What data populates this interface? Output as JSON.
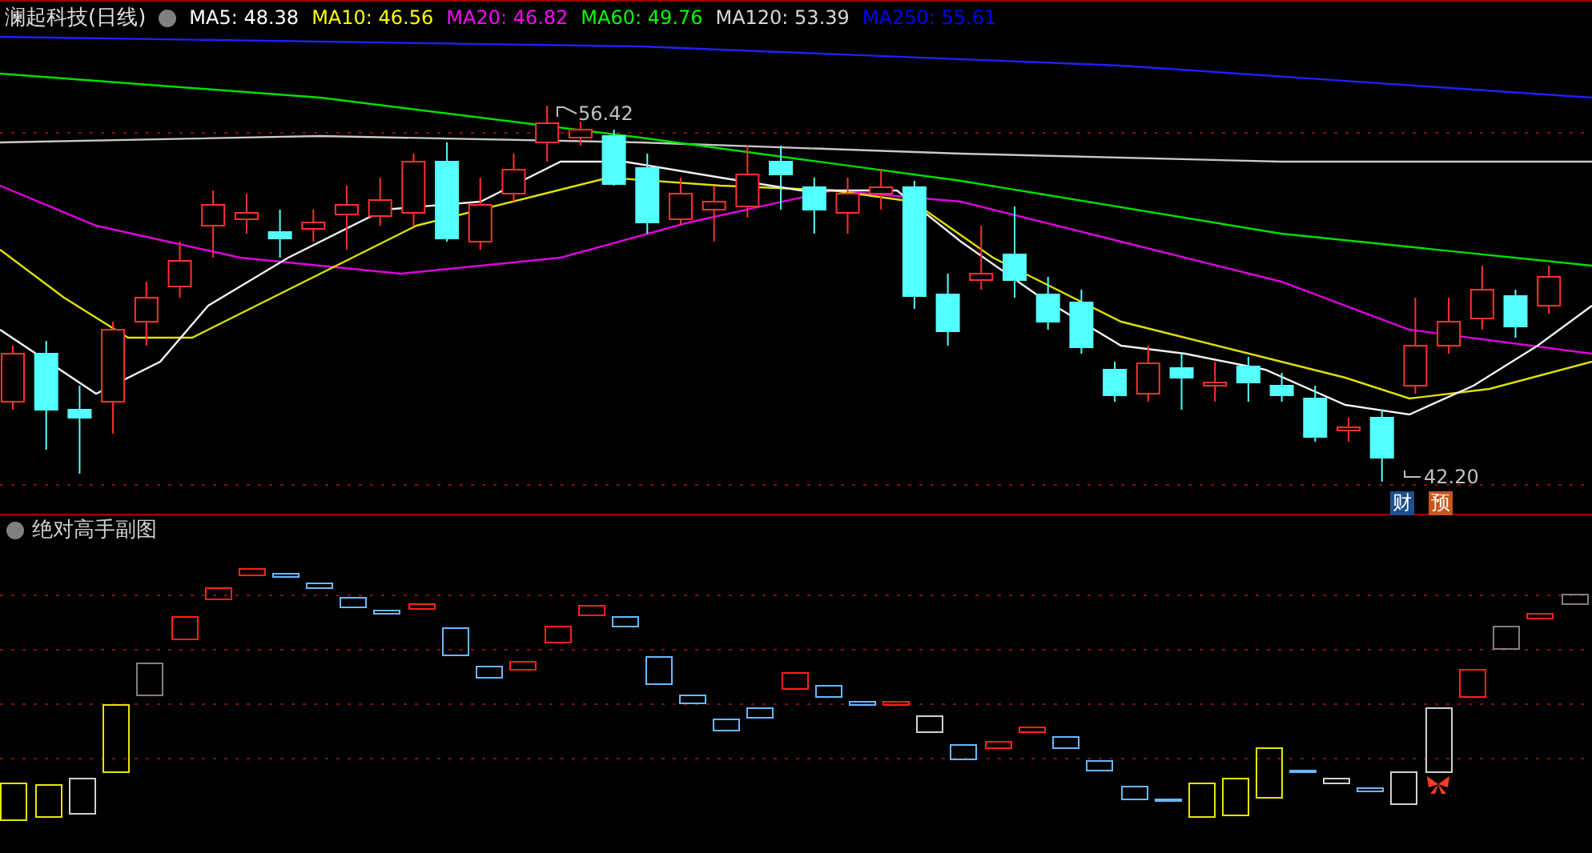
{
  "chart": {
    "title": "澜起科技(日线)",
    "indicators": [
      {
        "label": "MA5: 48.38",
        "color": "#ffffff"
      },
      {
        "label": "MA10: 46.56",
        "color": "#ffff00"
      },
      {
        "label": "MA20: 46.82",
        "color": "#ff00ff"
      },
      {
        "label": "MA60: 49.76",
        "color": "#00ff00"
      },
      {
        "label": "MA120: 53.39",
        "color": "#d8d8d8"
      },
      {
        "label": "MA250: 55.61",
        "color": "#0000ff"
      }
    ],
    "price_marks": [
      {
        "text": "56.42"
      },
      {
        "text": "42.20"
      }
    ],
    "event_badges": [
      {
        "text": "财",
        "color": "#1e4f8c"
      },
      {
        "text": "预",
        "color": "#c8561c"
      }
    ]
  },
  "subchart": {
    "title": "绝对高手副图"
  }
}
